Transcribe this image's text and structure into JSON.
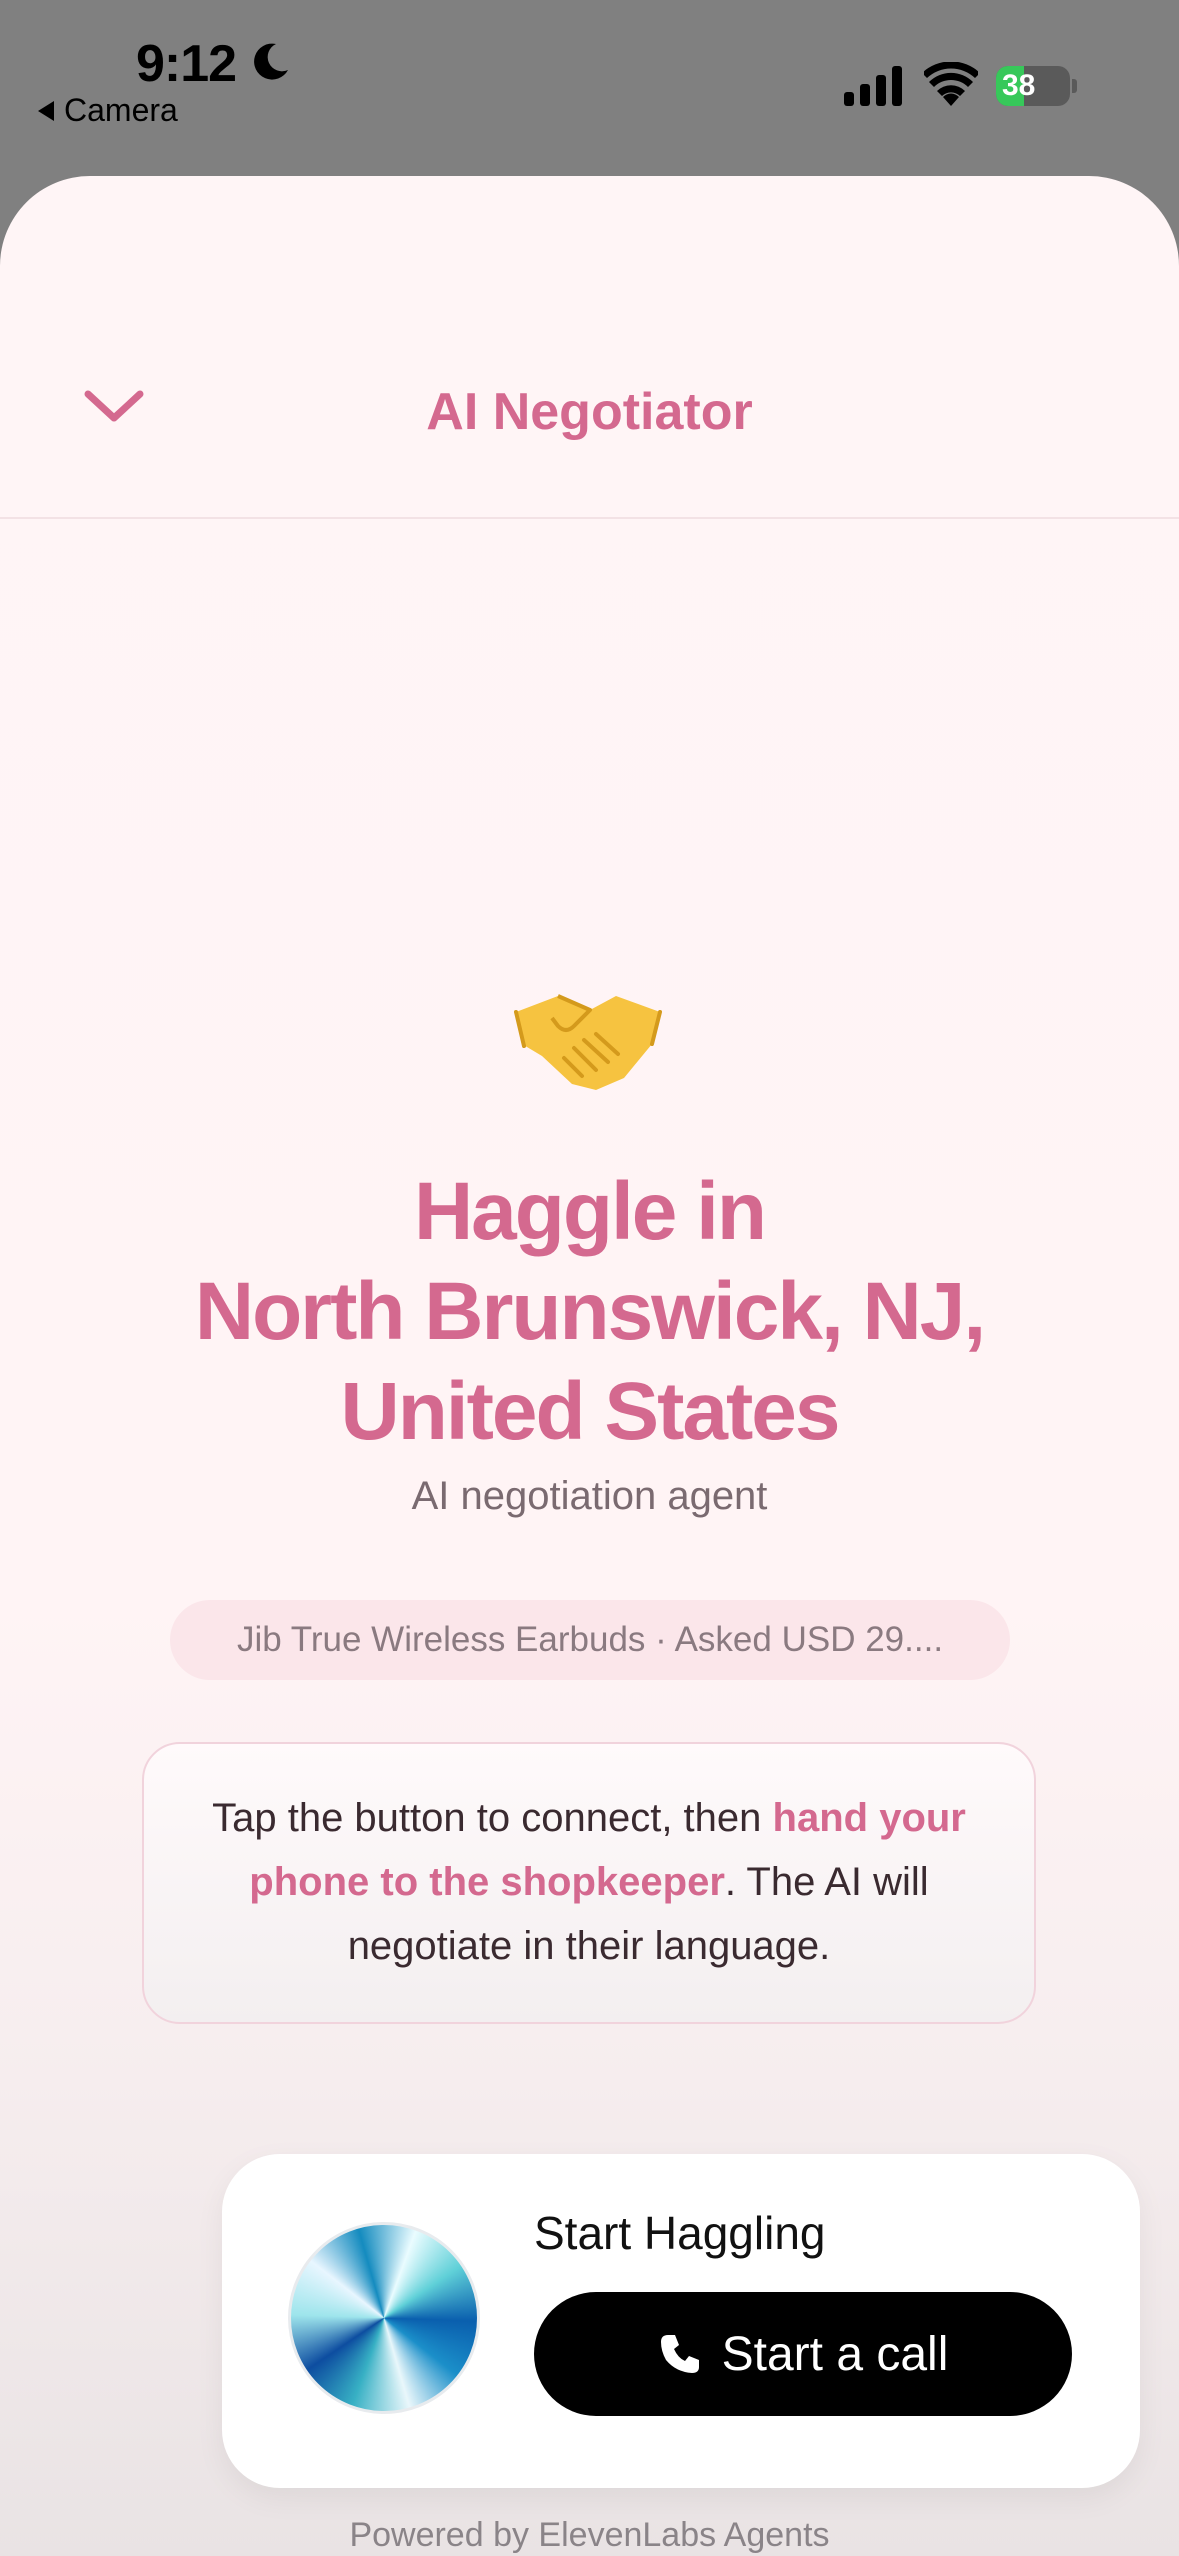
{
  "status_bar": {
    "time": "9:12",
    "back_app": "Camera",
    "battery": "38",
    "battery_level": 0.38
  },
  "header": {
    "title": "AI Negotiator"
  },
  "hero": {
    "emoji": "handshake",
    "title_lines": [
      "Haggle in",
      "North Brunswick, NJ,",
      "United States"
    ],
    "subtitle": "AI negotiation agent"
  },
  "item_pill": "Jib True Wireless Earbuds · Asked USD 29....",
  "instructions": {
    "before": "Tap the button to connect, then ",
    "highlight": "hand your phone to the shopkeeper",
    "after": ". The AI will negotiate in their language."
  },
  "widget": {
    "label": "Start Haggling",
    "call_button": "Start a call"
  },
  "footer": "Powered by ElevenLabs Agents",
  "colors": {
    "accent": "#d4698f",
    "background": "#fff5f6",
    "button": "#000000"
  },
  "icons": [
    "moon-icon",
    "signal-icon",
    "wifi-icon",
    "battery-icon",
    "chevron-down-icon",
    "handshake-icon",
    "phone-icon"
  ]
}
